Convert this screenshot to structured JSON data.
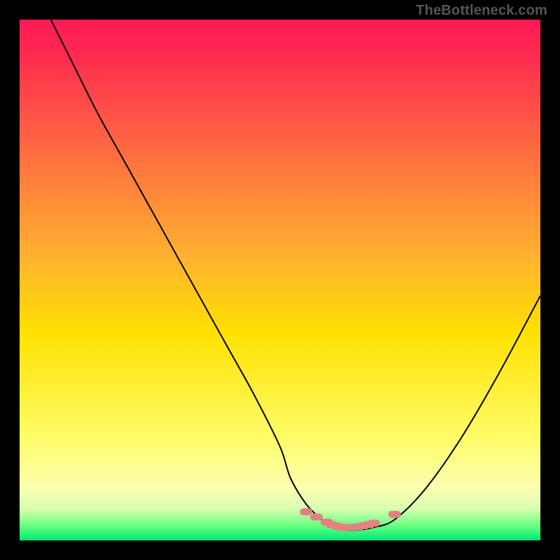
{
  "watermark": "TheBottleneck.com",
  "colors": {
    "frame": "#000000",
    "watermark": "#555555",
    "curve": "#000000",
    "marker_fill": "#e58080",
    "marker_stroke": "#d06a6a",
    "gradient_stops": [
      {
        "offset": 0.0,
        "color": "#ff1a55"
      },
      {
        "offset": 0.06,
        "color": "#ff2850"
      },
      {
        "offset": 0.45,
        "color": "#ffb030"
      },
      {
        "offset": 0.6,
        "color": "#ffe000"
      },
      {
        "offset": 0.8,
        "color": "#fffc66"
      },
      {
        "offset": 0.9,
        "color": "#fcffb0"
      },
      {
        "offset": 0.94,
        "color": "#d6ffb0"
      },
      {
        "offset": 0.975,
        "color": "#5cff7c"
      },
      {
        "offset": 1.0,
        "color": "#00e676"
      }
    ]
  },
  "chart_data": {
    "type": "line",
    "title": "",
    "xlabel": "",
    "ylabel": "",
    "xlim": [
      0,
      100
    ],
    "ylim": [
      0,
      100
    ],
    "grid": false,
    "legend": false,
    "series": [
      {
        "name": "bottleneck-curve",
        "x": [
          6,
          10,
          15,
          20,
          25,
          30,
          35,
          40,
          45,
          50,
          52,
          55,
          58,
          60,
          62,
          65,
          68,
          72,
          78,
          85,
          92,
          100
        ],
        "values": [
          100,
          92,
          82,
          73,
          64,
          55,
          46,
          37,
          28,
          18,
          12,
          7,
          4,
          2.5,
          2,
          2,
          2.5,
          4,
          10,
          20,
          32,
          47
        ]
      }
    ],
    "markers": {
      "name": "optimal-zone",
      "x": [
        55,
        57,
        59,
        60,
        61,
        62,
        63,
        64,
        65,
        66,
        67,
        68,
        72
      ],
      "values": [
        5.5,
        4.5,
        3.5,
        3,
        2.7,
        2.5,
        2.5,
        2.5,
        2.6,
        2.8,
        3,
        3.3,
        5
      ]
    }
  }
}
